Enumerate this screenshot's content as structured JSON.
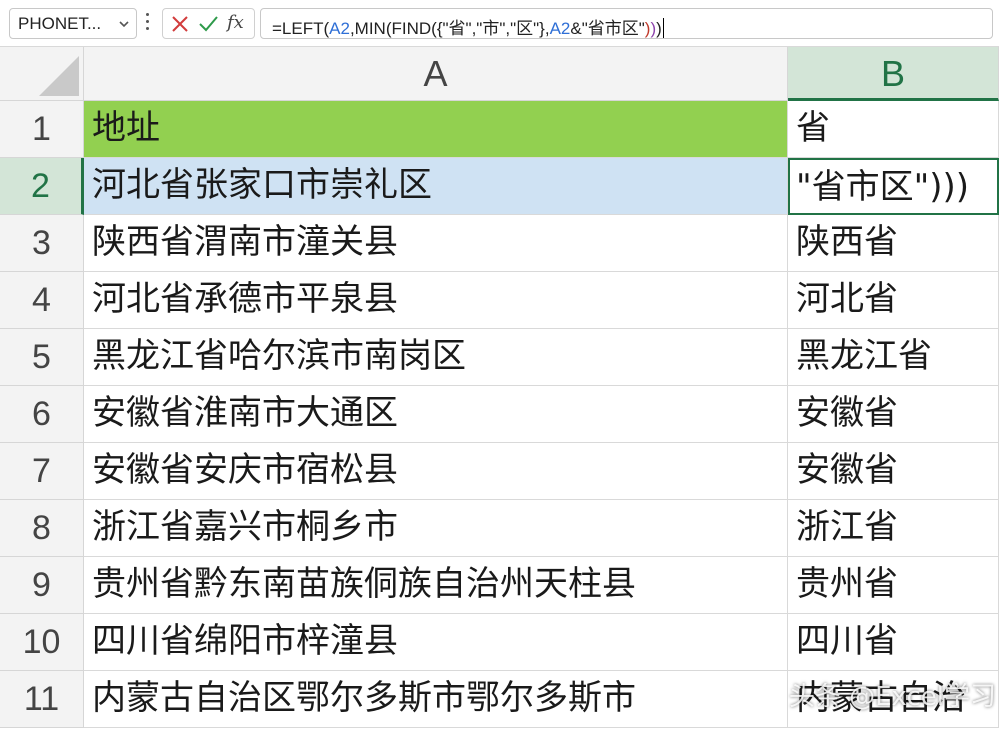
{
  "name_box": {
    "value": "PHONET..."
  },
  "formula_bar": {
    "fx_label": "fx",
    "parts": [
      {
        "text": "=LEFT(",
        "color": "#222222"
      },
      {
        "text": "A2",
        "color": "#2f6fd6"
      },
      {
        "text": ",MIN(FIND({\"省\",\"市\",\"区\"},",
        "color": "#222222"
      },
      {
        "text": "A2",
        "color": "#2f6fd6"
      },
      {
        "text": "&\"省市区\"",
        "color": "#222222"
      },
      {
        "text": ")",
        "color": "#c0392b"
      },
      {
        "text": ")",
        "color": "#8e44ad"
      },
      {
        "text": ")",
        "color": "#222222"
      }
    ]
  },
  "columns": [
    {
      "label": "A",
      "active": false
    },
    {
      "label": "B",
      "active": true
    }
  ],
  "rows": [
    {
      "num": "1",
      "a": "地址",
      "b": "省"
    },
    {
      "num": "2",
      "a": "河北省张家口市崇礼区",
      "b": "\"省市区\")))"
    },
    {
      "num": "3",
      "a": "陕西省渭南市潼关县",
      "b": "陕西省"
    },
    {
      "num": "4",
      "a": "河北省承德市平泉县",
      "b": "河北省"
    },
    {
      "num": "5",
      "a": "黑龙江省哈尔滨市南岗区",
      "b": "黑龙江省"
    },
    {
      "num": "6",
      "a": "安徽省淮南市大通区",
      "b": "安徽省"
    },
    {
      "num": "7",
      "a": "安徽省安庆市宿松县",
      "b": "安徽省"
    },
    {
      "num": "8",
      "a": "浙江省嘉兴市桐乡市",
      "b": "浙江省"
    },
    {
      "num": "9",
      "a": "贵州省黔东南苗族侗族自治州天柱县",
      "b": "贵州省"
    },
    {
      "num": "10",
      "a": "四川省绵阳市梓潼县",
      "b": "四川省"
    },
    {
      "num": "11",
      "a": "内蒙古自治区鄂尔多斯市鄂尔多斯市",
      "b": "内蒙古自治"
    }
  ],
  "active_row": "2",
  "watermark": "头条 @Excel学习",
  "colors": {
    "header_fill": "#92d050",
    "selection_fill": "#cfe2f3",
    "accent": "#217346"
  },
  "icons": {
    "cancel": "close-icon",
    "confirm": "check-icon",
    "function": "fx-icon",
    "dropdown": "chevron-down-icon",
    "more": "kebab-icon"
  }
}
